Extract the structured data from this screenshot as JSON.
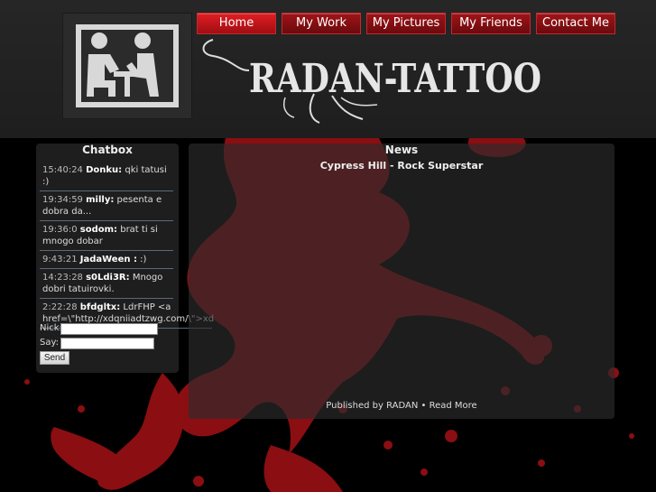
{
  "nav": {
    "items": [
      {
        "label": "Home"
      },
      {
        "label": "My Work"
      },
      {
        "label": "My Pictures"
      },
      {
        "label": "My Friends"
      },
      {
        "label": "Contact Me"
      }
    ]
  },
  "header": {
    "brand": "RADAN-TATTOO",
    "logo_icon": "tattoo-artist-icon"
  },
  "colors": {
    "accent": "#b0141a",
    "splatter": "#8a0e12",
    "header_bg": "#262626"
  },
  "chatbox": {
    "title": "Chatbox",
    "messages": [
      {
        "time": "15:40:24",
        "nick": "Donku:",
        "text": "qki tatusi :)"
      },
      {
        "time": "19:34:59",
        "nick": "milly:",
        "text": "pesenta e dobra da..."
      },
      {
        "time": "19:36:0",
        "nick": "sodom:",
        "text": "brat ti si mnogo dobar"
      },
      {
        "time": "9:43:21",
        "nick": "JadaWeen :",
        "text": ":)"
      },
      {
        "time": "14:23:28",
        "nick": "s0Ldi3R:",
        "text": "Mnogo dobri tatuirovki."
      },
      {
        "time": "2:22:28",
        "nick": "bfdgltx:",
        "text": "LdrFHP <a href=\\\"http://xdqniiadtzwg.com/\\\">xd"
      }
    ],
    "nick_label": "Nick:",
    "say_label": "Say:",
    "nick_value": "",
    "say_value": "",
    "send_label": "Send"
  },
  "news": {
    "title": "News",
    "post_title": "Cypress Hill - Rock Superstar",
    "published_by": "Published by RADAN",
    "separator": "•",
    "read_more": "Read More"
  }
}
